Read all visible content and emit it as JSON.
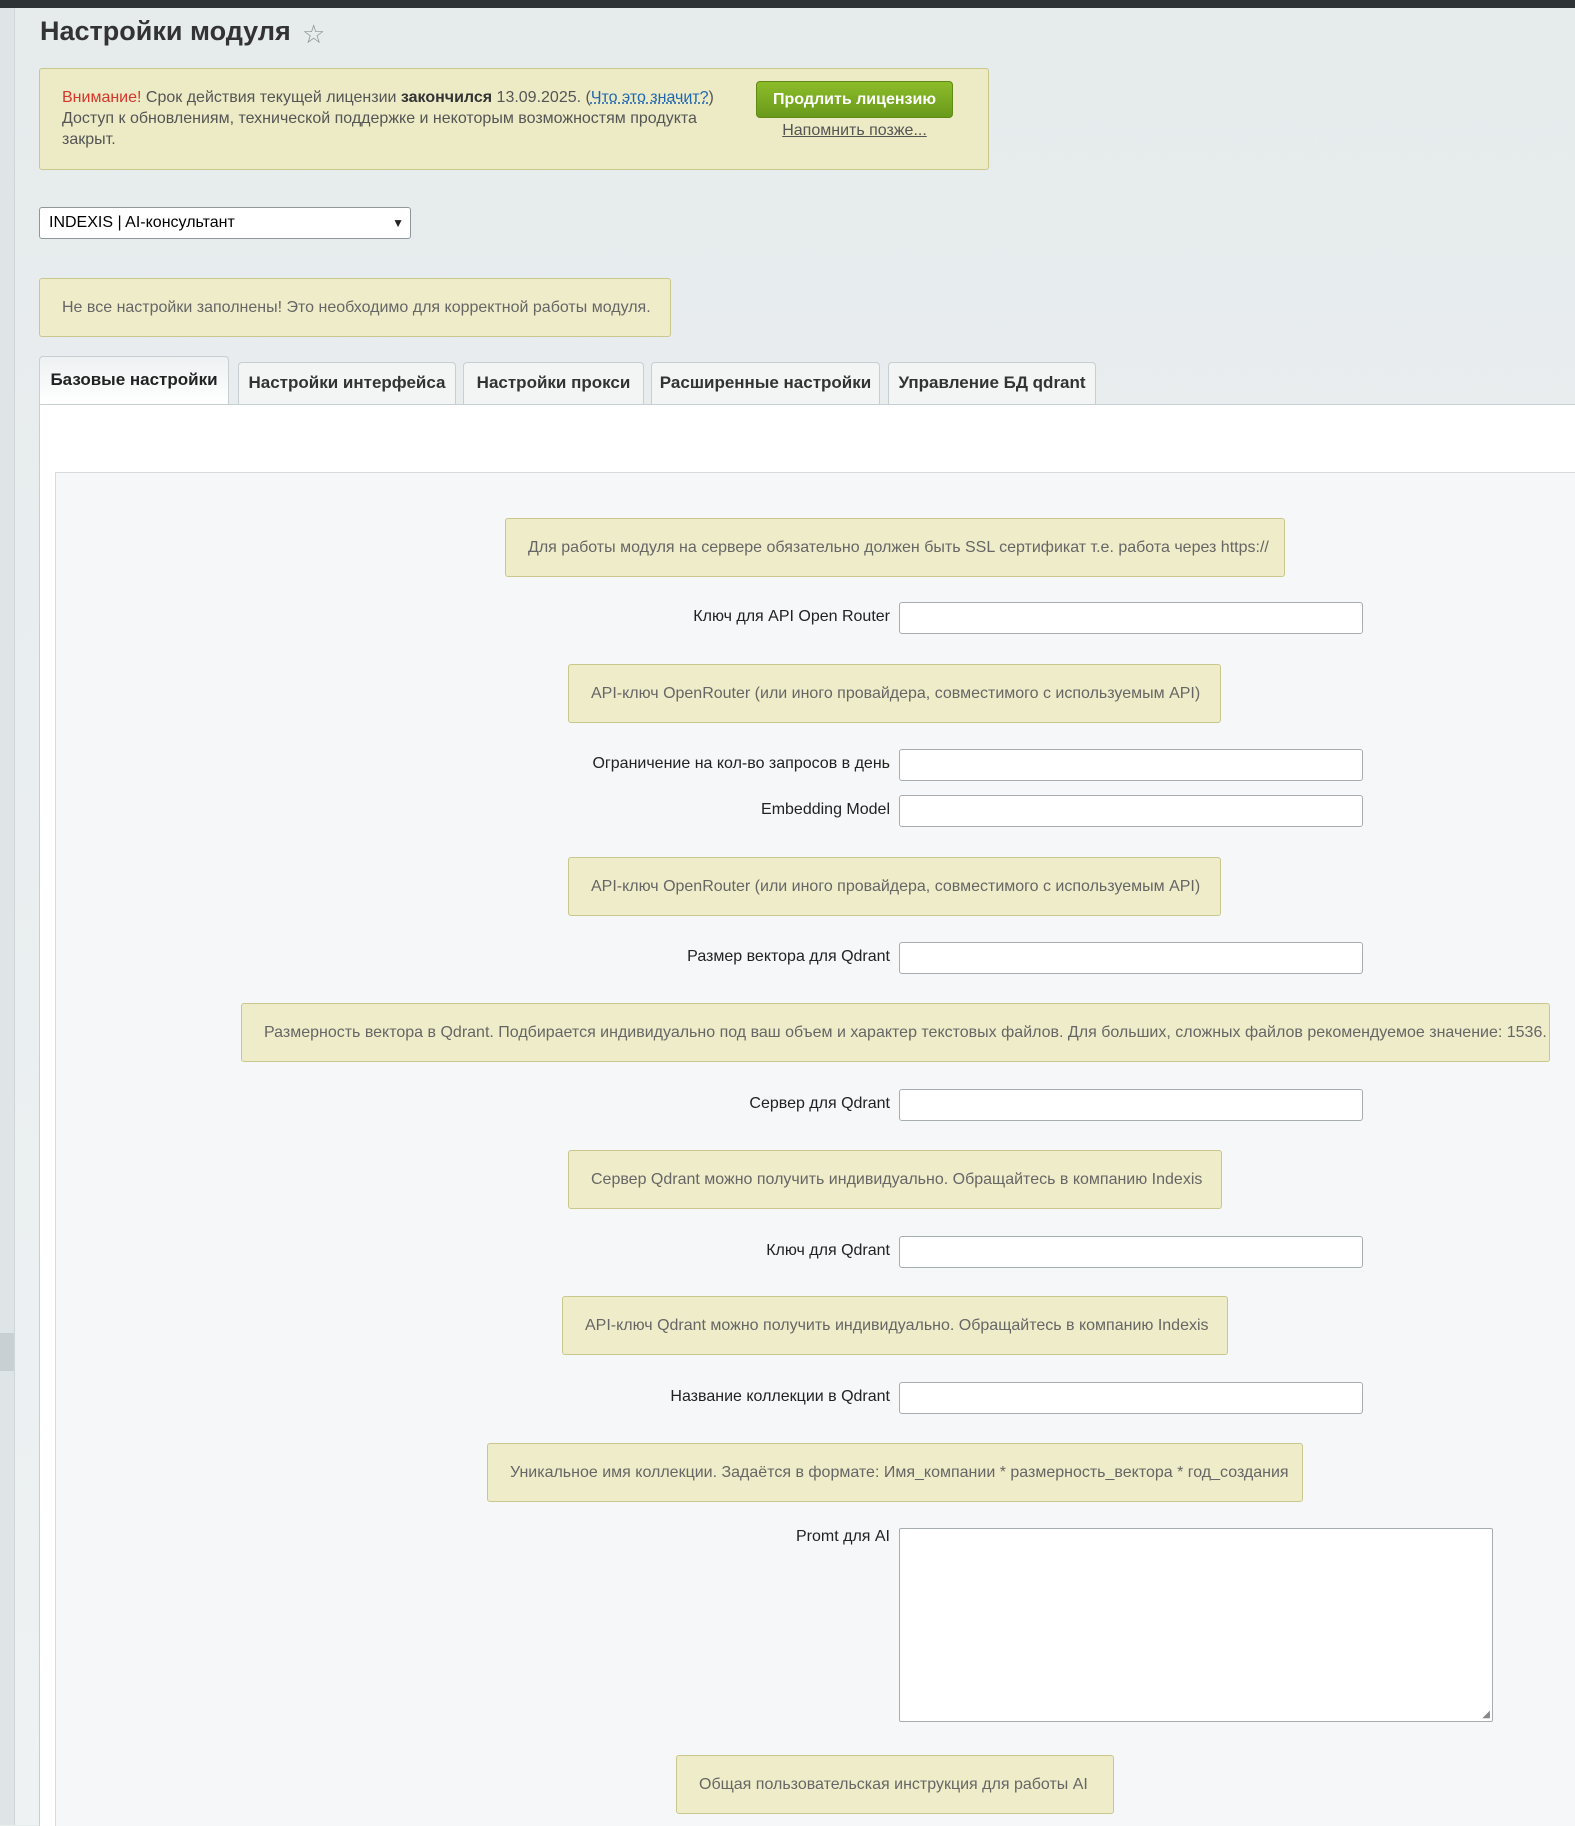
{
  "page": {
    "title": "Настройки модуля"
  },
  "license": {
    "warning_word": "Внимание!",
    "text_before": " Срок действия текущей лицензии ",
    "expired_word": "закончился",
    "date": " 13.09.2025. (",
    "link": "Что это значит?",
    "close_paren": ")",
    "line2": "Доступ к обновлениям, технической поддержке и некоторым возможностям продукта закрыт.",
    "renew_button": "Продлить лицензию",
    "remind_link": "Напомнить позже..."
  },
  "module_select": {
    "value": "INDEXIS | AI-консультант"
  },
  "alert": "Не все настройки заполнены! Это необходимо для корректной работы модуля.",
  "tabs": [
    {
      "label": "Базовые настройки"
    },
    {
      "label": "Настройки интерфейса"
    },
    {
      "label": "Настройки прокси"
    },
    {
      "label": "Расширенные настройки"
    },
    {
      "label": "Управление БД qdrant"
    }
  ],
  "form": {
    "ssl_note": "Для работы модуля на сервере обязательно должен быть SSL сертификат т.е. работа через https://",
    "fields": [
      {
        "label": "Ключ для API Open Router",
        "value": ""
      },
      {
        "label": "Ограничение на кол-во запросов в день",
        "value": ""
      },
      {
        "label": "Embedding Model",
        "value": ""
      },
      {
        "label": "Размер вектора для Qdrant",
        "value": ""
      },
      {
        "label": "Сервер для Qdrant",
        "value": ""
      },
      {
        "label": "Ключ для Qdrant",
        "value": ""
      },
      {
        "label": "Название коллекции в Qdrant",
        "value": ""
      },
      {
        "label": "Promt для AI",
        "value": ""
      }
    ],
    "hints": [
      "API-ключ OpenRouter (или иного провайдера, совместимого с используемым API)",
      "API-ключ OpenRouter (или иного провайдера, совместимого с используемым API)",
      "Размерность вектора в Qdrant. Подбирается индивидуально под ваш объем и характер текстовых файлов. Для больших, сложных файлов рекомендуемое значение: 1536.",
      "Сервер Qdrant можно получить индивидуально. Обращайтесь в компанию Indexis",
      "API-ключ Qdrant можно получить индивидуально. Обращайтесь в компанию Indexis",
      "Уникальное имя коллекции. Задаётся в формате: Имя_компании * размерность_вектора * год_создания",
      "Общая пользовательская инструкция для работы AI"
    ]
  }
}
